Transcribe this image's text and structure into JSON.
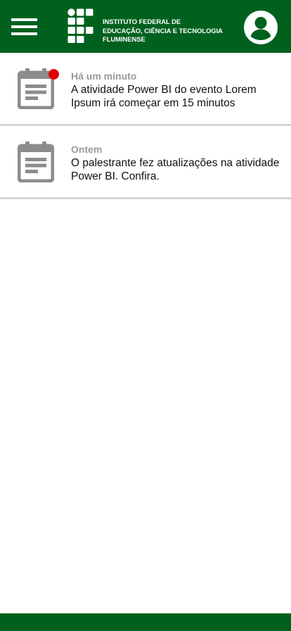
{
  "header": {
    "logo_lines": [
      "INSTITUTO FEDERAL DE",
      "EDUCAÇÃO, CIÊNCIA E TECNOLOGIA",
      "FLUMINENSE"
    ],
    "icons": {
      "menu": "hamburger-menu-icon",
      "profile": "account-circle-icon"
    }
  },
  "notifications": [
    {
      "time": "Há um minuto",
      "message": "A atividade Power BI do evento Lorem Ipsum irá começar em 15 minutos",
      "unread": true,
      "icon": "calendar-icon"
    },
    {
      "time": "Ontem",
      "message": "O palestrante fez atualizações na atividade Power BI. Confira.",
      "unread": false,
      "icon": "calendar-icon"
    }
  ],
  "colors": {
    "brand_green": "#00611e",
    "unread_dot": "#e00000",
    "icon_gray": "#8c8c8c",
    "time_gray": "#9a9a9a"
  }
}
